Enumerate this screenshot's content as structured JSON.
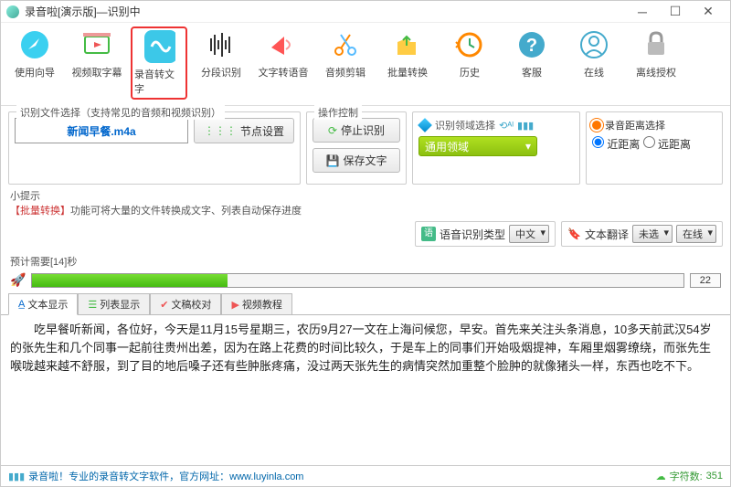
{
  "title": "录音啦[演示版]—识别中",
  "toolbar": [
    {
      "label": "使用向导"
    },
    {
      "label": "视频取字幕"
    },
    {
      "label": "录音转文字"
    },
    {
      "label": "分段识别"
    },
    {
      "label": "文字转语音"
    },
    {
      "label": "音频剪辑"
    },
    {
      "label": "批量转换"
    },
    {
      "label": "历史"
    },
    {
      "label": "客服"
    },
    {
      "label": "在线"
    },
    {
      "label": "离线授权"
    }
  ],
  "fileSelect": {
    "title": "识别文件选择（支持常见的音频和视频识别）",
    "file": "新闻早餐.m4a",
    "nodeBtn": "节点设置"
  },
  "opCtrl": {
    "title": "操作控制",
    "stop": "停止识别",
    "save": "保存文字"
  },
  "domain": {
    "head": "识别领域选择",
    "value": "通用领域"
  },
  "dist": {
    "title": "录音距离选择",
    "opt1": "近距离",
    "opt2": "远距离"
  },
  "hint": {
    "h1": "小提示",
    "h2": "【批量转换】",
    "h3": "功能可将大量的文件转换成文字、列表自动保存进度"
  },
  "langRow": {
    "label": "语音识别类型",
    "val": "中文",
    "transLabel": "文本翻译",
    "transVal": "未选",
    "online": "在线"
  },
  "est": "预计需要[14]秒",
  "progress": {
    "val": "22",
    "pct": 30
  },
  "tabs": [
    {
      "label": "文本显示"
    },
    {
      "label": "列表显示"
    },
    {
      "label": "文稿校对"
    },
    {
      "label": "视频教程"
    }
  ],
  "content": "　　吃早餐听新闻，各位好，今天是11月15号星期三，农历9月27一文在上海问候您，早安。首先来关注头条消息，10多天前武汉54岁的张先生和几个同事一起前往贵州出差，因为在路上花费的时间比较久，于是车上的同事们开始吸烟提神，车厢里烟雾缭绕，而张先生喉咙越来越不舒服，到了目的地后嗓子还有些肿胀疼痛，没过两天张先生的病情突然加重整个脸肿的就像猪头一样，东西也吃不下。",
  "status": {
    "s1": "录音啦！专业的录音转文字软件，官方网址：www.luyinla.com",
    "s2l": "字符数:",
    "s2v": "351"
  }
}
